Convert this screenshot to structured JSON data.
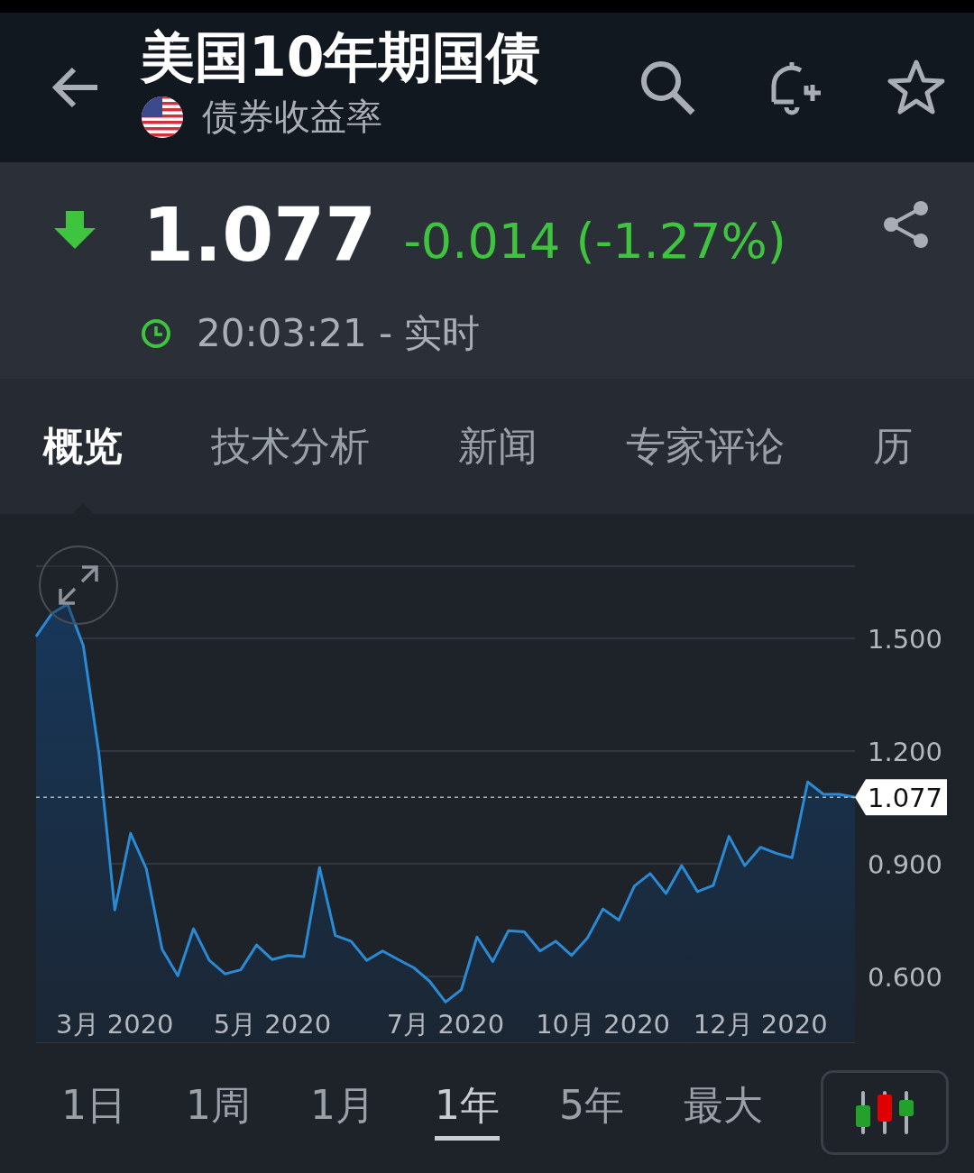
{
  "header": {
    "title": "美国10年期国债",
    "subtitle": "债券收益率"
  },
  "quote": {
    "price": "1.077",
    "falling": true,
    "change": "-0.014 (-1.27%)",
    "time": "20:03:21 - 实时"
  },
  "tabs": [
    {
      "label": "概览",
      "selected": true
    },
    {
      "label": "技术分析",
      "selected": false
    },
    {
      "label": "新闻",
      "selected": false
    },
    {
      "label": "专家评论",
      "selected": false
    },
    {
      "label": "历",
      "selected": false
    }
  ],
  "chart": {
    "chart_data": {
      "type": "area",
      "grid": true,
      "categories": [
        null,
        null,
        null,
        null,
        null,
        "3月 2020",
        null,
        null,
        null,
        null,
        null,
        null,
        null,
        null,
        null,
        "5月 2020",
        null,
        null,
        null,
        null,
        null,
        null,
        null,
        null,
        null,
        null,
        "7月 2020",
        null,
        null,
        null,
        null,
        null,
        null,
        null,
        null,
        null,
        "10月 2020",
        null,
        null,
        null,
        null,
        null,
        null,
        null,
        null,
        null,
        "12月 2020",
        null,
        null,
        null,
        null,
        null,
        null
      ],
      "values": [
        1.505,
        1.566,
        1.591,
        1.48,
        1.192,
        0.777,
        0.981,
        0.887,
        0.673,
        0.602,
        0.727,
        0.643,
        0.607,
        0.618,
        0.684,
        0.645,
        0.656,
        0.653,
        0.89,
        0.709,
        0.694,
        0.643,
        0.668,
        0.645,
        0.623,
        0.587,
        0.532,
        0.565,
        0.705,
        0.64,
        0.722,
        0.719,
        0.668,
        0.694,
        0.656,
        0.702,
        0.78,
        0.75,
        0.841,
        0.874,
        0.821,
        0.895,
        0.826,
        0.842,
        0.973,
        0.895,
        0.944,
        0.928,
        0.916,
        1.118,
        1.085,
        1.085,
        1.077
      ],
      "ylim": [
        0.425,
        1.692
      ],
      "yticks": [
        {
          "value": 1.5,
          "label": "1.500"
        },
        {
          "value": 1.2,
          "label": "1.200"
        },
        {
          "value": 0.9,
          "label": "0.900"
        },
        {
          "value": 0.6,
          "label": "0.600"
        }
      ],
      "ref_lines": [
        {
          "axis": "y",
          "value": 1.077,
          "label": "1.077"
        }
      ]
    }
  },
  "ranges": [
    {
      "label": "1日",
      "selected": false
    },
    {
      "label": "1周",
      "selected": false
    },
    {
      "label": "1月",
      "selected": false
    },
    {
      "label": "1年",
      "selected": true
    },
    {
      "label": "5年",
      "selected": false
    },
    {
      "label": "最大",
      "selected": false
    }
  ]
}
